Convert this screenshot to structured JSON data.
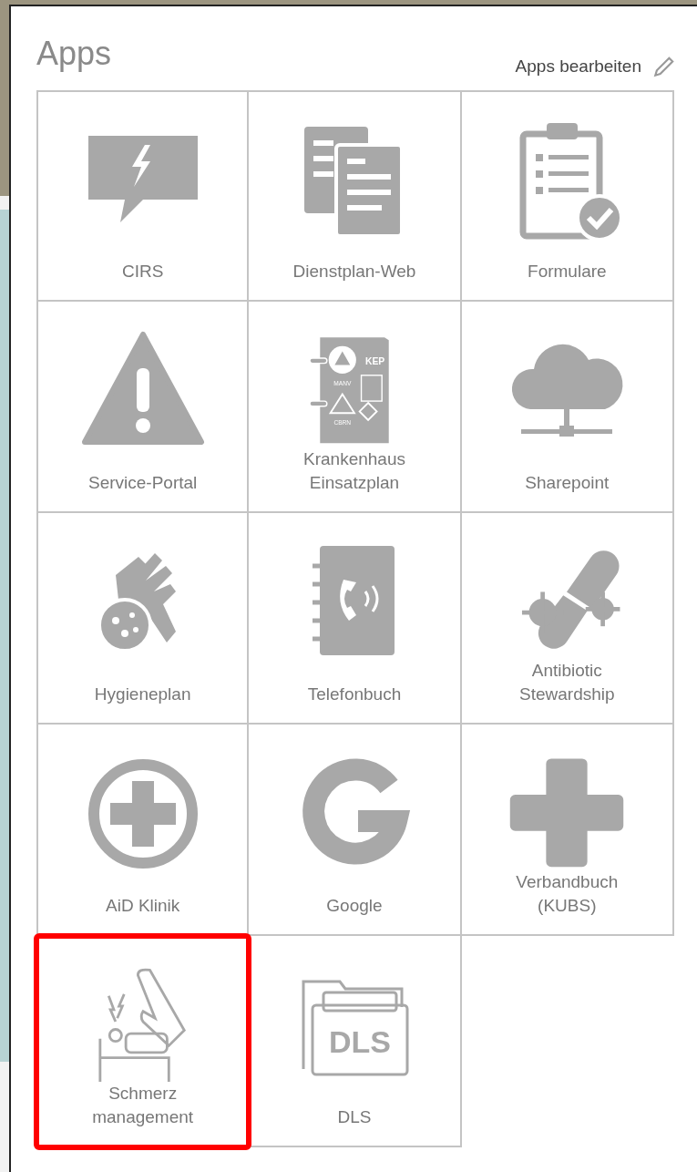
{
  "panel": {
    "title": "Apps",
    "edit_link": "Apps bearbeiten"
  },
  "apps": [
    {
      "label": "CIRS",
      "highlighted": false
    },
    {
      "label": "Dienstplan-Web",
      "highlighted": false
    },
    {
      "label": "Formulare",
      "highlighted": false
    },
    {
      "label": "Service-Portal",
      "highlighted": false
    },
    {
      "label": "Krankenhaus\nEinsatzplan",
      "highlighted": false,
      "icon_texts": [
        "KEP",
        "MANV",
        "CBRN"
      ]
    },
    {
      "label": "Sharepoint",
      "highlighted": false
    },
    {
      "label": "Hygieneplan",
      "highlighted": false
    },
    {
      "label": "Telefonbuch",
      "highlighted": false
    },
    {
      "label": "Antibiotic\nStewardship",
      "highlighted": false
    },
    {
      "label": "AiD Klinik",
      "highlighted": false
    },
    {
      "label": "Google",
      "highlighted": false
    },
    {
      "label": "Verbandbuch\n(KUBS)",
      "highlighted": false
    },
    {
      "label": "Schmerz\nmanagement",
      "highlighted": true
    },
    {
      "label": "DLS",
      "highlighted": false,
      "icon_texts": [
        "DLS"
      ]
    }
  ]
}
